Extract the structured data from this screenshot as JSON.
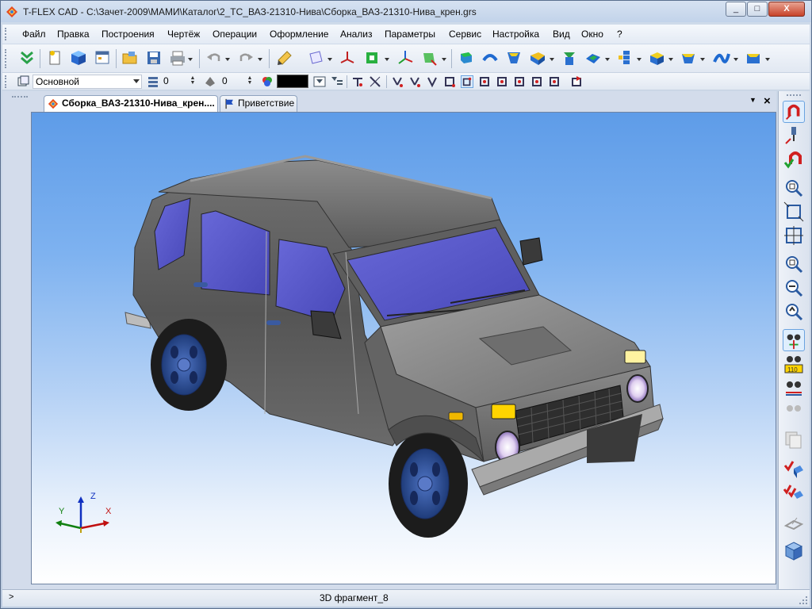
{
  "window": {
    "title": "T-FLEX CAD - C:\\Зачет-2009\\МАМИ\\Каталог\\2_ТС_ВАЗ-21310-Нива\\Сборка_ВАЗ-21310-Нива_крен.grs",
    "minimize": "_",
    "maximize": "□",
    "close": "X"
  },
  "menu": {
    "items": [
      "Файл",
      "Правка",
      "Построения",
      "Чертёж",
      "Операции",
      "Оформление",
      "Анализ",
      "Параметры",
      "Сервис",
      "Настройка",
      "Вид",
      "Окно",
      "?"
    ]
  },
  "toolbar2": {
    "layer_value": "Основной",
    "level_value": "0",
    "priority_value": "0",
    "color_swatch": "#000000"
  },
  "tabs": {
    "active_label": "Сборка_ВАЗ-21310-Нива_крен....",
    "second_label": "Приветствие",
    "dropdown": "▼",
    "close": "×"
  },
  "axes": {
    "x": "X",
    "y": "Y",
    "z": "Z"
  },
  "status": {
    "arrow": ">",
    "text": "3D фрагмент_8"
  },
  "icons": {
    "toolbar_main": [
      "double-chevron-down-icon",
      "new-document-icon",
      "3d-cube-icon",
      "window-icon",
      "open-folder-icon",
      "save-icon",
      "print-icon",
      "undo-icon",
      "redo-icon",
      "edit-pen-icon",
      "workplane-icon",
      "3d-node-icon",
      "profile-icon",
      "axes-icon",
      "lcs-icon",
      "extrude-icon",
      "rotate-icon",
      "loft-icon",
      "sweep-icon",
      "boolean-icon",
      "shell-icon",
      "array-icon",
      "fillet-icon",
      "chamfer-icon",
      "surface-icon",
      "body-icon"
    ],
    "right_panel": [
      "magnet-snap-icon",
      "pin-snap-icon",
      "magnet-check-icon",
      "zoom-window-icon",
      "zoom-extents-icon",
      "zoom-all-icon",
      "zoom-in-icon",
      "zoom-out-icon",
      "zoom-previous-icon",
      "visibility-icon",
      "dimension-icon",
      "glasses-icon",
      "hidden-icon",
      "copy-pages-icon",
      "check-blue-cube-icon",
      "double-check-cube-icon",
      "workplane-gray-icon",
      "cube-view-icon"
    ]
  },
  "colors": {
    "viewport_top": "#5e9ce8",
    "viewport_bottom": "#ffffff",
    "car_body": "#6a6a6a",
    "glass": "#6a6ad8",
    "wheel_rim": "#2f4f8f",
    "indicator": "#ffd400"
  }
}
